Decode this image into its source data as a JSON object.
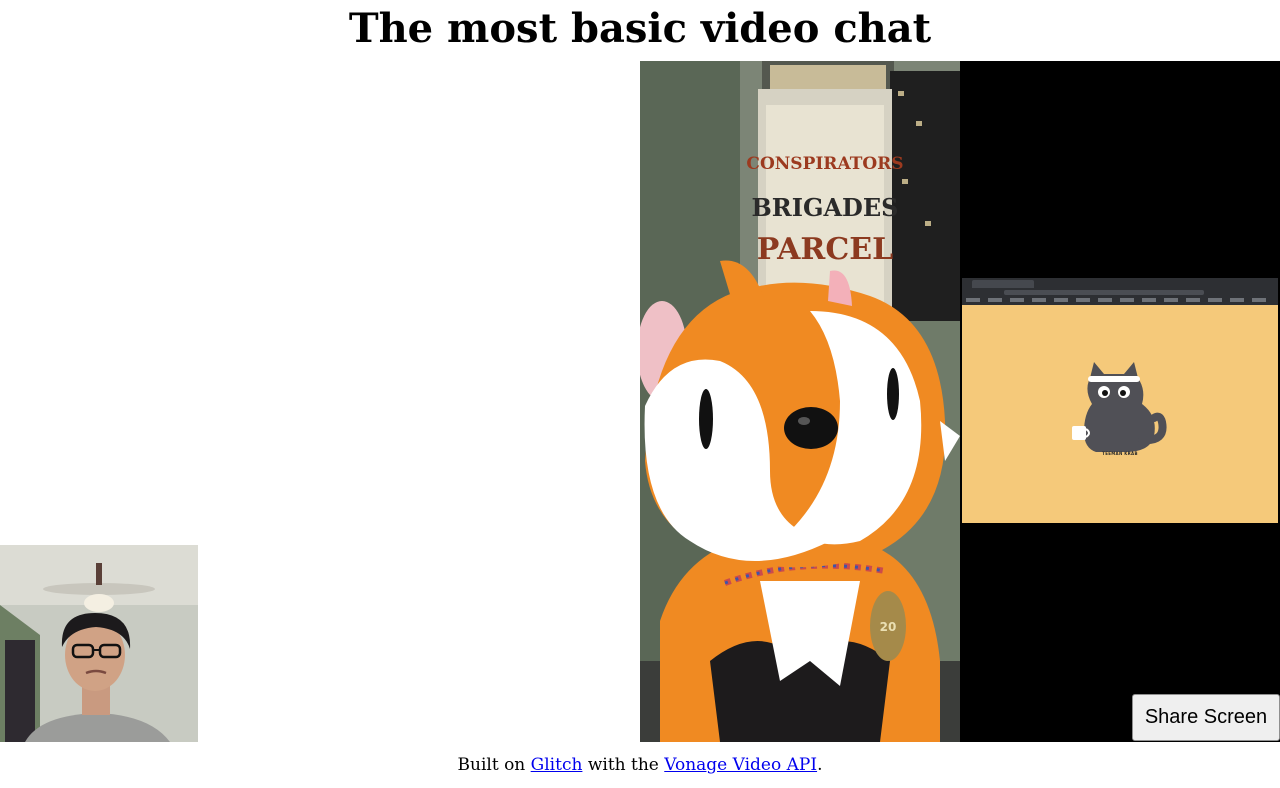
{
  "header": {
    "title": "The most basic video chat"
  },
  "videos": {
    "screen_share": {
      "cat_caption": "TEEMAN KRAB"
    }
  },
  "controls": {
    "share_screen_label": "Share Screen"
  },
  "footer": {
    "prefix": "Built on ",
    "glitch_link": "Glitch",
    "middle": " with the ",
    "vonage_link": "Vonage Video API",
    "suffix": "."
  },
  "colors": {
    "link": "#0000ee",
    "screen_share_background": "#000000",
    "shared_page_background": "#f5c97a"
  }
}
